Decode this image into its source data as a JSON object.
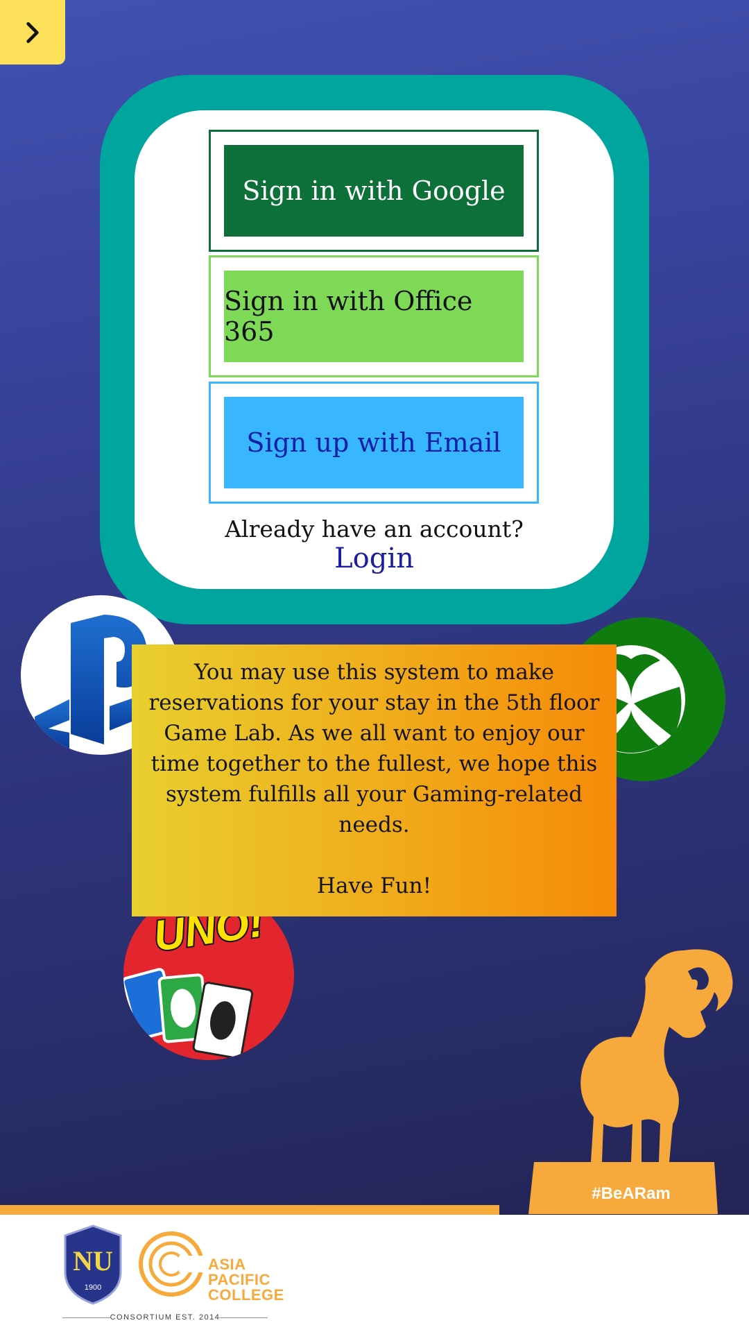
{
  "nav": {
    "icon": "chevron-right-icon"
  },
  "signin": {
    "google_label": "Sign in with Google",
    "office_label": "Sign in with Office 365",
    "email_label": "Sign up with Email",
    "already_text": "Already have an account?",
    "login_label": "Login"
  },
  "message": {
    "body": "You may use this system to make reservations for your stay in the 5th floor Game Lab.  As we all want to enjoy our time together to the fullest, we hope this system fulfills all your Gaming-related needs.",
    "closing": "Have Fun!"
  },
  "decor": {
    "uno_text": "UNO!",
    "hashtag": "#BeARam"
  },
  "footer": {
    "seal_text": "1900",
    "apc_lines": [
      "ASIA",
      "PACIFIC",
      "COLLEGE"
    ],
    "consortium": "CONSORTIUM EST. 2014"
  },
  "colors": {
    "google_green": "#0d7038",
    "office_green": "#7ed957",
    "email_blue": "#38b6ff",
    "teal": "#00a59e",
    "accent_orange": "#f7a93b",
    "nav_yellow": "#fde05a"
  }
}
